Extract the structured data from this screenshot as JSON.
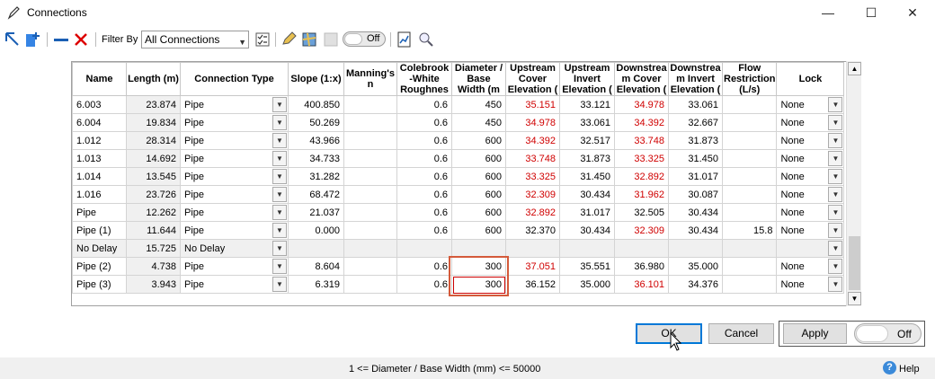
{
  "window": {
    "title": "Connections",
    "minimize_glyph": "—",
    "maximize_glyph": "☐",
    "close_glyph": "✕"
  },
  "toolbar": {
    "filter_label": "Filter By",
    "filter_value": "All Connections",
    "toggle_label": "Off",
    "icons": [
      "select-tool-icon",
      "add-connection-icon",
      "remove-icon",
      "delete-icon",
      "checklist-icon",
      "edit-icon",
      "map-icon",
      "map-disabled-icon",
      "report-icon",
      "find-icon"
    ]
  },
  "grid": {
    "headers": {
      "name": "Name",
      "length": "Length (m)",
      "ctype": "Connection Type",
      "slope": "Slope (1:x)",
      "manning": "Manning's n",
      "colebrook": "Colebrook -White Roughnes",
      "diameter": "Diameter / Base Width (m",
      "us_cover": "Upstream Cover Elevation (",
      "us_invert": "Upstream Invert Elevation (",
      "ds_cover": "Downstrea m Cover Elevation (",
      "ds_invert": "Downstrea m Invert Elevation (",
      "flow": "Flow Restriction (L/s)",
      "lock": "Lock"
    },
    "rows": [
      {
        "name": "6.003",
        "length": "23.874",
        "ctype": "Pipe",
        "slope": "400.850",
        "manning": "",
        "colebrook": "0.6",
        "diameter": "450",
        "us_cover": "35.151",
        "us_invert": "33.121",
        "ds_cover": "34.978",
        "ds_invert": "33.061",
        "flow": "",
        "lock": "None"
      },
      {
        "name": "6.004",
        "length": "19.834",
        "ctype": "Pipe",
        "slope": "50.269",
        "manning": "",
        "colebrook": "0.6",
        "diameter": "450",
        "us_cover": "34.978",
        "us_invert": "33.061",
        "ds_cover": "34.392",
        "ds_invert": "32.667",
        "flow": "",
        "lock": "None"
      },
      {
        "name": "1.012",
        "length": "28.314",
        "ctype": "Pipe",
        "slope": "43.966",
        "manning": "",
        "colebrook": "0.6",
        "diameter": "600",
        "us_cover": "34.392",
        "us_invert": "32.517",
        "ds_cover": "33.748",
        "ds_invert": "31.873",
        "flow": "",
        "lock": "None"
      },
      {
        "name": "1.013",
        "length": "14.692",
        "ctype": "Pipe",
        "slope": "34.733",
        "manning": "",
        "colebrook": "0.6",
        "diameter": "600",
        "us_cover": "33.748",
        "us_invert": "31.873",
        "ds_cover": "33.325",
        "ds_invert": "31.450",
        "flow": "",
        "lock": "None"
      },
      {
        "name": "1.014",
        "length": "13.545",
        "ctype": "Pipe",
        "slope": "31.282",
        "manning": "",
        "colebrook": "0.6",
        "diameter": "600",
        "us_cover": "33.325",
        "us_invert": "31.450",
        "ds_cover": "32.892",
        "ds_invert": "31.017",
        "flow": "",
        "lock": "None"
      },
      {
        "name": "1.016",
        "length": "23.726",
        "ctype": "Pipe",
        "slope": "68.472",
        "manning": "",
        "colebrook": "0.6",
        "diameter": "600",
        "us_cover": "32.309",
        "us_invert": "30.434",
        "ds_cover": "31.962",
        "ds_invert": "30.087",
        "flow": "",
        "lock": "None"
      },
      {
        "name": "Pipe",
        "length": "12.262",
        "ctype": "Pipe",
        "slope": "21.037",
        "manning": "",
        "colebrook": "0.6",
        "diameter": "600",
        "us_cover": "32.892",
        "us_invert": "31.017",
        "ds_cover": "32.505",
        "ds_invert": "30.434",
        "flow": "",
        "lock": "None"
      },
      {
        "name": "Pipe (1)",
        "length": "11.644",
        "ctype": "Pipe",
        "slope": "0.000",
        "manning": "",
        "colebrook": "0.6",
        "diameter": "600",
        "us_cover": "32.370",
        "us_invert": "30.434",
        "ds_cover": "32.309",
        "ds_invert": "30.434",
        "flow": "15.8",
        "lock": "None"
      },
      {
        "name": "No Delay",
        "length": "15.725",
        "ctype": "No Delay",
        "slope": "",
        "manning": "",
        "colebrook": "",
        "diameter": "",
        "us_cover": "",
        "us_invert": "",
        "ds_cover": "",
        "ds_invert": "",
        "flow": "",
        "lock": ""
      },
      {
        "name": "Pipe (2)",
        "length": "4.738",
        "ctype": "Pipe",
        "slope": "8.604",
        "manning": "",
        "colebrook": "0.6",
        "diameter": "300",
        "us_cover": "37.051",
        "us_invert": "35.551",
        "ds_cover": "36.980",
        "ds_invert": "35.000",
        "flow": "",
        "lock": "None"
      },
      {
        "name": "Pipe (3)",
        "length": "3.943",
        "ctype": "Pipe",
        "slope": "6.319",
        "manning": "",
        "colebrook": "0.6",
        "diameter": "",
        "us_cover": "36.152",
        "us_invert": "35.000",
        "ds_cover": "36.101",
        "ds_invert": "34.376",
        "flow": "",
        "lock": "None"
      }
    ],
    "red_cells": [
      [
        "us_cover",
        "ds_cover"
      ],
      [
        "us_cover",
        "ds_cover"
      ],
      [
        "us_cover",
        "ds_cover"
      ],
      [
        "us_cover",
        "ds_cover"
      ],
      [
        "us_cover",
        "ds_cover"
      ],
      [
        "us_cover",
        "ds_cover"
      ],
      [
        "us_cover"
      ],
      [
        "ds_cover"
      ],
      [],
      [
        "us_cover"
      ],
      [
        "ds_cover"
      ]
    ],
    "editing_value": "300"
  },
  "buttons": {
    "ok": "OK",
    "cancel": "Cancel",
    "apply": "Apply",
    "apply_toggle": "Off"
  },
  "status": {
    "message": "1 <= Diameter / Base Width (mm) <= 50000",
    "help": "Help"
  },
  "colors": {
    "error_text": "#d00000",
    "highlight_border": "#d45a3a",
    "ok_focus": "#0078d7"
  }
}
